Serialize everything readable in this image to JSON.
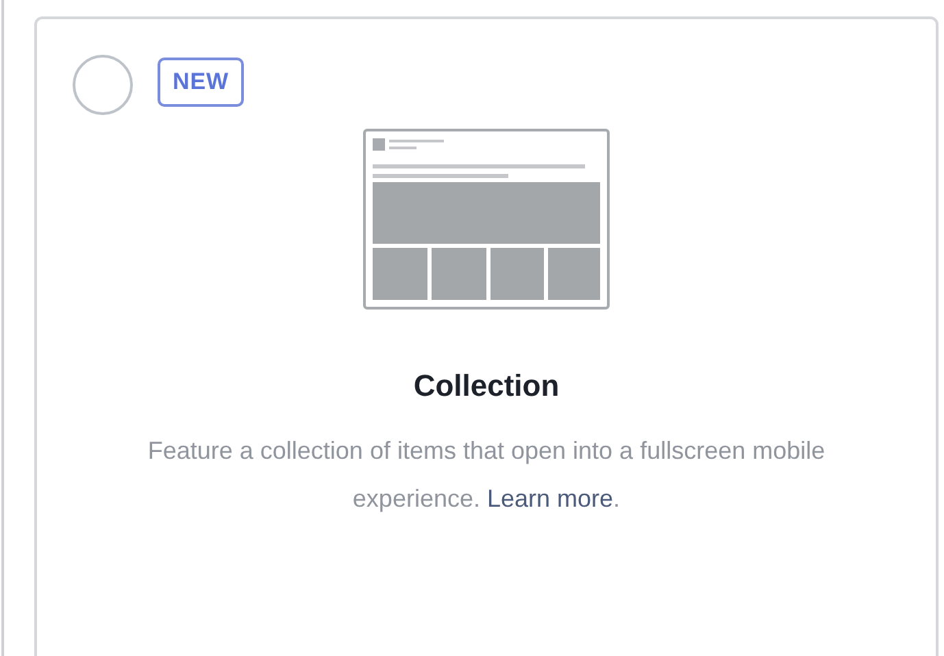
{
  "option_card": {
    "selected": false,
    "badge": "NEW",
    "kind": "picture",
    "title": "Collection",
    "description": "Feature a collection of items that open into a fullscreen mobile experience.",
    "link": "Learn more",
    "link_suffix": "."
  }
}
